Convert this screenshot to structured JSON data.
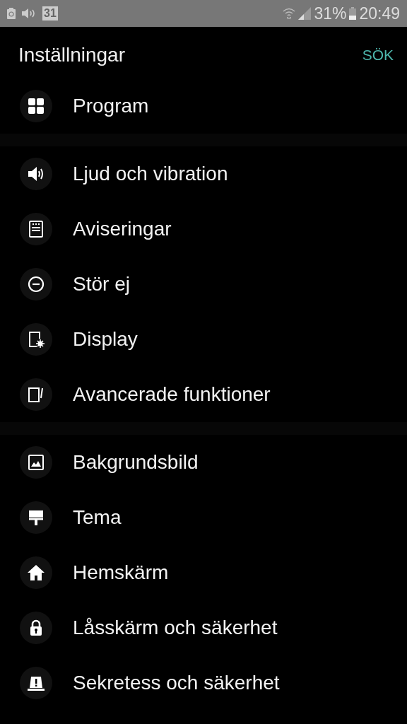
{
  "status_bar": {
    "calendar_day": "31",
    "battery": "31%",
    "time": "20:49"
  },
  "header": {
    "title": "Inställningar",
    "search": "SÖK"
  },
  "groups": [
    {
      "items": [
        {
          "label": "Program",
          "kind": "apps"
        }
      ]
    },
    {
      "items": [
        {
          "label": "Ljud och vibration",
          "kind": "sound"
        },
        {
          "label": "Aviseringar",
          "kind": "notifications"
        },
        {
          "label": "Stör ej",
          "kind": "dnd"
        },
        {
          "label": "Display",
          "kind": "display"
        },
        {
          "label": "Avancerade funktioner",
          "kind": "advanced"
        }
      ]
    },
    {
      "items": [
        {
          "label": "Bakgrundsbild",
          "kind": "wallpaper"
        },
        {
          "label": "Tema",
          "kind": "theme"
        },
        {
          "label": "Hemskärm",
          "kind": "home"
        },
        {
          "label": "Låsskärm och säkerhet",
          "kind": "lock"
        },
        {
          "label": "Sekretess och säkerhet",
          "kind": "privacy"
        }
      ]
    }
  ]
}
